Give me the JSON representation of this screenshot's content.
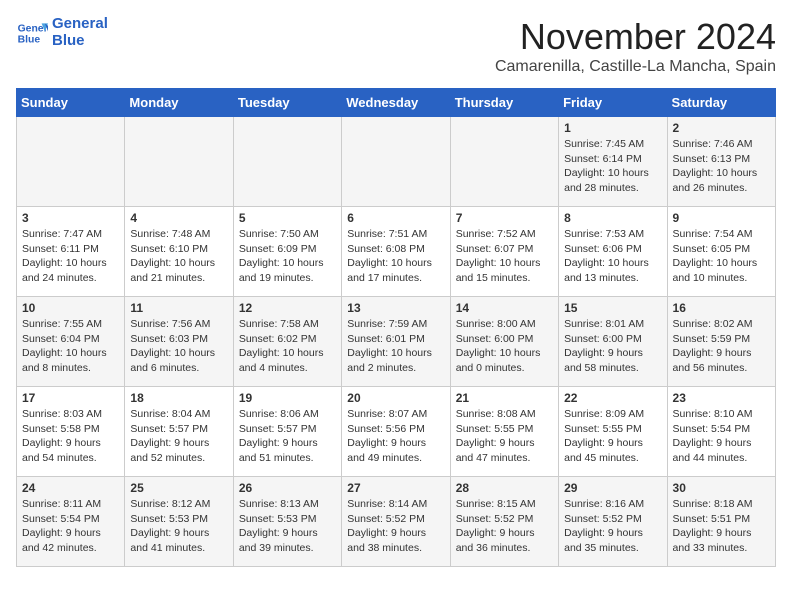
{
  "header": {
    "logo_line1": "General",
    "logo_line2": "Blue",
    "title": "November 2024",
    "location": "Camarenilla, Castille-La Mancha, Spain"
  },
  "days_of_week": [
    "Sunday",
    "Monday",
    "Tuesday",
    "Wednesday",
    "Thursday",
    "Friday",
    "Saturday"
  ],
  "weeks": [
    [
      {
        "num": "",
        "info": ""
      },
      {
        "num": "",
        "info": ""
      },
      {
        "num": "",
        "info": ""
      },
      {
        "num": "",
        "info": ""
      },
      {
        "num": "",
        "info": ""
      },
      {
        "num": "1",
        "info": "Sunrise: 7:45 AM\nSunset: 6:14 PM\nDaylight: 10 hours\nand 28 minutes."
      },
      {
        "num": "2",
        "info": "Sunrise: 7:46 AM\nSunset: 6:13 PM\nDaylight: 10 hours\nand 26 minutes."
      }
    ],
    [
      {
        "num": "3",
        "info": "Sunrise: 7:47 AM\nSunset: 6:11 PM\nDaylight: 10 hours\nand 24 minutes."
      },
      {
        "num": "4",
        "info": "Sunrise: 7:48 AM\nSunset: 6:10 PM\nDaylight: 10 hours\nand 21 minutes."
      },
      {
        "num": "5",
        "info": "Sunrise: 7:50 AM\nSunset: 6:09 PM\nDaylight: 10 hours\nand 19 minutes."
      },
      {
        "num": "6",
        "info": "Sunrise: 7:51 AM\nSunset: 6:08 PM\nDaylight: 10 hours\nand 17 minutes."
      },
      {
        "num": "7",
        "info": "Sunrise: 7:52 AM\nSunset: 6:07 PM\nDaylight: 10 hours\nand 15 minutes."
      },
      {
        "num": "8",
        "info": "Sunrise: 7:53 AM\nSunset: 6:06 PM\nDaylight: 10 hours\nand 13 minutes."
      },
      {
        "num": "9",
        "info": "Sunrise: 7:54 AM\nSunset: 6:05 PM\nDaylight: 10 hours\nand 10 minutes."
      }
    ],
    [
      {
        "num": "10",
        "info": "Sunrise: 7:55 AM\nSunset: 6:04 PM\nDaylight: 10 hours\nand 8 minutes."
      },
      {
        "num": "11",
        "info": "Sunrise: 7:56 AM\nSunset: 6:03 PM\nDaylight: 10 hours\nand 6 minutes."
      },
      {
        "num": "12",
        "info": "Sunrise: 7:58 AM\nSunset: 6:02 PM\nDaylight: 10 hours\nand 4 minutes."
      },
      {
        "num": "13",
        "info": "Sunrise: 7:59 AM\nSunset: 6:01 PM\nDaylight: 10 hours\nand 2 minutes."
      },
      {
        "num": "14",
        "info": "Sunrise: 8:00 AM\nSunset: 6:00 PM\nDaylight: 10 hours\nand 0 minutes."
      },
      {
        "num": "15",
        "info": "Sunrise: 8:01 AM\nSunset: 6:00 PM\nDaylight: 9 hours\nand 58 minutes."
      },
      {
        "num": "16",
        "info": "Sunrise: 8:02 AM\nSunset: 5:59 PM\nDaylight: 9 hours\nand 56 minutes."
      }
    ],
    [
      {
        "num": "17",
        "info": "Sunrise: 8:03 AM\nSunset: 5:58 PM\nDaylight: 9 hours\nand 54 minutes."
      },
      {
        "num": "18",
        "info": "Sunrise: 8:04 AM\nSunset: 5:57 PM\nDaylight: 9 hours\nand 52 minutes."
      },
      {
        "num": "19",
        "info": "Sunrise: 8:06 AM\nSunset: 5:57 PM\nDaylight: 9 hours\nand 51 minutes."
      },
      {
        "num": "20",
        "info": "Sunrise: 8:07 AM\nSunset: 5:56 PM\nDaylight: 9 hours\nand 49 minutes."
      },
      {
        "num": "21",
        "info": "Sunrise: 8:08 AM\nSunset: 5:55 PM\nDaylight: 9 hours\nand 47 minutes."
      },
      {
        "num": "22",
        "info": "Sunrise: 8:09 AM\nSunset: 5:55 PM\nDaylight: 9 hours\nand 45 minutes."
      },
      {
        "num": "23",
        "info": "Sunrise: 8:10 AM\nSunset: 5:54 PM\nDaylight: 9 hours\nand 44 minutes."
      }
    ],
    [
      {
        "num": "24",
        "info": "Sunrise: 8:11 AM\nSunset: 5:54 PM\nDaylight: 9 hours\nand 42 minutes."
      },
      {
        "num": "25",
        "info": "Sunrise: 8:12 AM\nSunset: 5:53 PM\nDaylight: 9 hours\nand 41 minutes."
      },
      {
        "num": "26",
        "info": "Sunrise: 8:13 AM\nSunset: 5:53 PM\nDaylight: 9 hours\nand 39 minutes."
      },
      {
        "num": "27",
        "info": "Sunrise: 8:14 AM\nSunset: 5:52 PM\nDaylight: 9 hours\nand 38 minutes."
      },
      {
        "num": "28",
        "info": "Sunrise: 8:15 AM\nSunset: 5:52 PM\nDaylight: 9 hours\nand 36 minutes."
      },
      {
        "num": "29",
        "info": "Sunrise: 8:16 AM\nSunset: 5:52 PM\nDaylight: 9 hours\nand 35 minutes."
      },
      {
        "num": "30",
        "info": "Sunrise: 8:18 AM\nSunset: 5:51 PM\nDaylight: 9 hours\nand 33 minutes."
      }
    ]
  ]
}
